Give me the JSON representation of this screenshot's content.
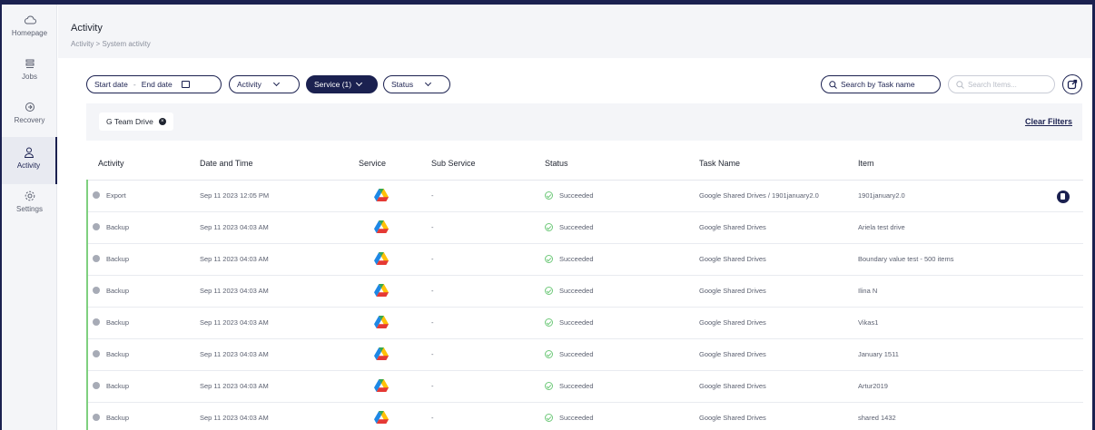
{
  "sidebar": {
    "items": [
      {
        "label": "Homepage",
        "icon": "cloud-icon",
        "active": false
      },
      {
        "label": "Jobs",
        "icon": "jobs-icon",
        "active": false
      },
      {
        "label": "Recovery",
        "icon": "recovery-icon",
        "active": false
      },
      {
        "label": "Activity",
        "icon": "user-icon",
        "active": true
      },
      {
        "label": "Settings",
        "icon": "gear-icon",
        "active": false
      }
    ]
  },
  "header": {
    "title": "Activity",
    "breadcrumb": "Activity > System activity"
  },
  "filters": {
    "start_date": "Start date",
    "separator": "-",
    "end_date": "End date",
    "activity": "Activity",
    "service": "Service (1)",
    "status": "Status",
    "search_task": "Search by Task name",
    "search_items": "Search Items...",
    "chip": "G Team Drive",
    "clear": "Clear Filters"
  },
  "table": {
    "columns": [
      "Activity",
      "Date and Time",
      "Service",
      "Sub Service",
      "Status",
      "Task Name",
      "Item"
    ],
    "rows": [
      {
        "activity": "Export",
        "datetime": "Sep 11 2023 12:05 PM",
        "service": "google-drive-icon",
        "sub_service": "-",
        "status": "Succeeded",
        "task": "Google Shared Drives / 1901january2.0",
        "item": "1901january2.0",
        "has_action": true
      },
      {
        "activity": "Backup",
        "datetime": "Sep 11 2023 04:03 AM",
        "service": "google-drive-icon",
        "sub_service": "-",
        "status": "Succeeded",
        "task": "Google Shared Drives",
        "item": "Ariela test drive",
        "has_action": false
      },
      {
        "activity": "Backup",
        "datetime": "Sep 11 2023 04:03 AM",
        "service": "google-drive-icon",
        "sub_service": "-",
        "status": "Succeeded",
        "task": "Google Shared Drives",
        "item": "Boundary value test - 500 items",
        "has_action": false
      },
      {
        "activity": "Backup",
        "datetime": "Sep 11 2023 04:03 AM",
        "service": "google-drive-icon",
        "sub_service": "-",
        "status": "Succeeded",
        "task": "Google Shared Drives",
        "item": "Ilina N",
        "has_action": false
      },
      {
        "activity": "Backup",
        "datetime": "Sep 11 2023 04:03 AM",
        "service": "google-drive-icon",
        "sub_service": "-",
        "status": "Succeeded",
        "task": "Google Shared Drives",
        "item": "Vikas1",
        "has_action": false
      },
      {
        "activity": "Backup",
        "datetime": "Sep 11 2023 04:03 AM",
        "service": "google-drive-icon",
        "sub_service": "-",
        "status": "Succeeded",
        "task": "Google Shared Drives",
        "item": "January 1511",
        "has_action": false
      },
      {
        "activity": "Backup",
        "datetime": "Sep 11 2023 04:03 AM",
        "service": "google-drive-icon",
        "sub_service": "-",
        "status": "Succeeded",
        "task": "Google Shared Drives",
        "item": "Artur2019",
        "has_action": false
      },
      {
        "activity": "Backup",
        "datetime": "Sep 11 2023 04:03 AM",
        "service": "google-drive-icon",
        "sub_service": "-",
        "status": "Succeeded",
        "task": "Google Shared Drives",
        "item": "shared 1432",
        "has_action": false
      }
    ]
  },
  "colors": {
    "brand": "#1b2150",
    "success": "#6fc97a",
    "row_marker": "#7fd07f"
  }
}
